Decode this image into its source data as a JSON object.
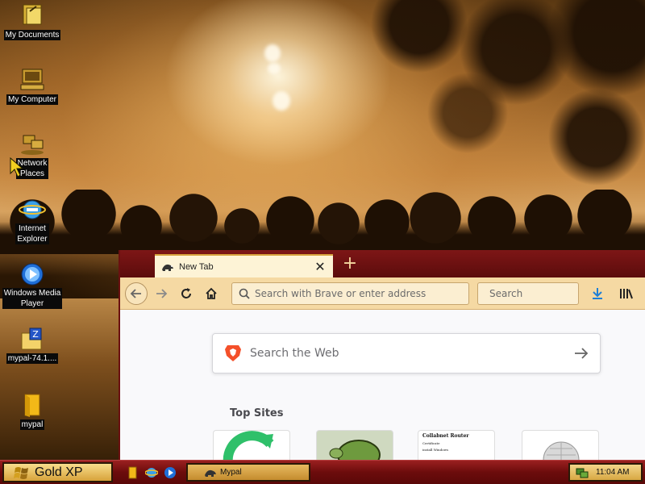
{
  "desktop": {
    "icons": [
      {
        "label": "My Documents",
        "icon": "my-documents-icon"
      },
      {
        "label": "My Computer",
        "icon": "my-computer-icon"
      },
      {
        "label_line1": "Network",
        "label_line2": "Places",
        "icon": "network-places-icon"
      },
      {
        "label_line1": "Internet",
        "label_line2": "Explorer",
        "icon": "internet-explorer-icon"
      },
      {
        "label_line1": "Windows Media",
        "label_line2": "Player",
        "icon": "windows-media-player-icon"
      },
      {
        "label": "mypal-74.1....",
        "icon": "zip-archive-icon"
      },
      {
        "label": "mypal",
        "icon": "folder-icon"
      }
    ]
  },
  "browser": {
    "tab": {
      "title": "New Tab",
      "close": "✕"
    },
    "new_tab": "+",
    "address_placeholder": "Search with Brave or enter address",
    "search_placeholder": "Search",
    "web_search_placeholder": "Search the Web",
    "top_sites_heading": "Top Sites",
    "top_sites": [
      {
        "site": "tile-1"
      },
      {
        "site": "tile-2"
      },
      {
        "title": "Collabnet Router",
        "line2": "Certificate",
        "line3": "install Windows"
      },
      {
        "site": "tile-4"
      }
    ]
  },
  "taskbar": {
    "start_label": "Gold XP",
    "task_label": "Mypal",
    "clock": "11:04 AM"
  },
  "colors": {
    "titlebar": "#7d1616",
    "toolbar": "#f5d9a3",
    "tab": "#fdf3d6",
    "taskbar": "#6c0c0c",
    "start_button": "#d7a23a",
    "download_accent": "#1e7fd6"
  }
}
